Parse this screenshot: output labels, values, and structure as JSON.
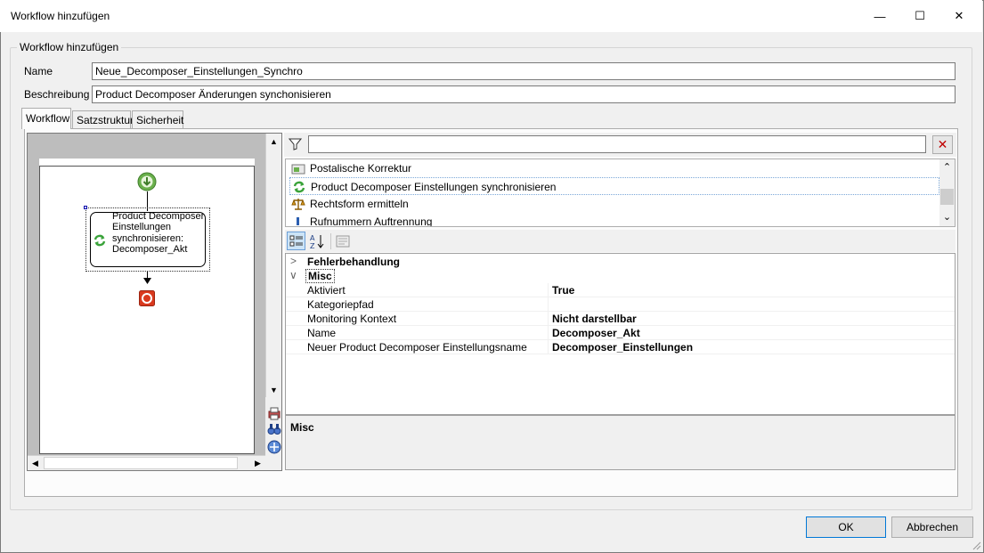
{
  "window": {
    "title": "Workflow hinzufügen",
    "minimize_glyph": "—",
    "maximize_glyph": "☐",
    "close_glyph": "✕"
  },
  "group": {
    "legend": "Workflow hinzufügen"
  },
  "form": {
    "name_label": "Name",
    "name_value": "Neue_Decomposer_Einstellungen_Synchro",
    "description_label": "Beschreibung",
    "description_value": "Product Decomposer Änderungen synchonisieren"
  },
  "tabs": [
    {
      "label": "Workflow",
      "active": true
    },
    {
      "label": "Satzstruktur",
      "active": false
    },
    {
      "label": "Sicherheit",
      "active": false
    }
  ],
  "designer": {
    "activity_label": "Product Decomposer Einstellungen synchronisieren: Decomposer_Akt",
    "start_icon": "start-arrow-icon",
    "end_icon": "stop-icon"
  },
  "activity_list": {
    "filter_value": "",
    "items": [
      {
        "label": "Postalische Korrektur",
        "icon": "postal-correction-icon"
      },
      {
        "label": "Product Decomposer Einstellungen synchronisieren",
        "icon": "sync-icon",
        "selected": true
      },
      {
        "label": "Rechtsform ermitteln",
        "icon": "scales-icon"
      },
      {
        "label": "Rufnummern Auftrennung",
        "icon": "phone-split-icon"
      }
    ]
  },
  "property_grid": {
    "categories": [
      {
        "label": "Fehlerbehandlung",
        "expanded": false
      },
      {
        "label": "Misc",
        "expanded": true
      }
    ],
    "rows": [
      {
        "name": "Aktiviert",
        "value": "True"
      },
      {
        "name": "Kategoriepfad",
        "value": ""
      },
      {
        "name": "Monitoring Kontext",
        "value": "Nicht darstellbar"
      },
      {
        "name": "Name",
        "value": "Decomposer_Akt"
      },
      {
        "name": "Neuer Product Decomposer Einstellungsname",
        "value": "Decomposer_Einstellungen"
      }
    ],
    "description_title": "Misc"
  },
  "buttons": {
    "ok": "OK",
    "cancel": "Abbrechen"
  },
  "colors": {
    "accent": "#0078d7",
    "sync_green": "#3aa33a",
    "stop_red": "#d9391e"
  }
}
